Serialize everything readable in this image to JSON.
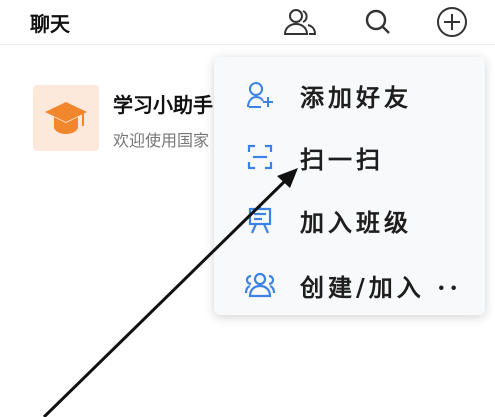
{
  "header": {
    "title": "聊天",
    "icons": [
      "contacts-icon",
      "search-icon",
      "plus-circle-icon"
    ]
  },
  "conversation": {
    "title": "学习小助手",
    "subtitle": "欢迎使用国家",
    "avatar_icon": "graduation-cap-icon",
    "avatar_color": "#f0872d"
  },
  "menu": {
    "items": [
      {
        "label": "添加好友",
        "icon": "add-user-icon"
      },
      {
        "label": "扫一扫",
        "icon": "scan-icon"
      },
      {
        "label": "加入班级",
        "icon": "class-board-icon"
      },
      {
        "label": "创建/加入 ··",
        "icon": "group-icon"
      }
    ],
    "accent": "#3b82e6"
  }
}
